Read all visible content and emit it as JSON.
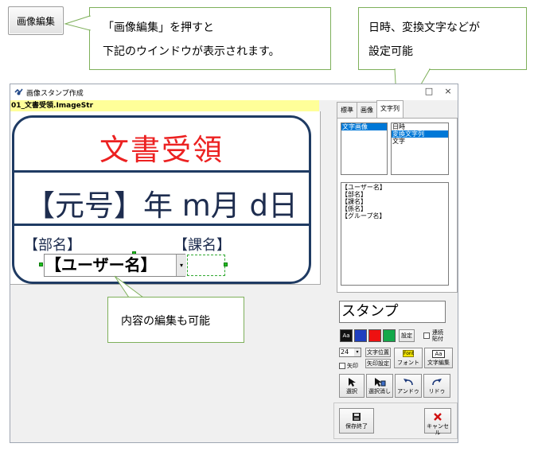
{
  "top_button": {
    "label": "画像編集"
  },
  "callouts": {
    "left": {
      "line1": "「画像編集」を押すと",
      "line2": "下記のウインドウが表示されます。"
    },
    "right": {
      "line1": "日時、変換文字などが",
      "line2": "設定可能"
    },
    "bottom": {
      "line1": "内容の編集も可能"
    }
  },
  "window": {
    "title": "画像スタンプ作成",
    "filename": "01_文書受領.ImageStr",
    "controls": {
      "maximize": "□",
      "close": "×"
    }
  },
  "stamp": {
    "title": "文書受領",
    "date_line": "【元号】年 m月 d日",
    "dept": "【部名】",
    "section": "【課名】",
    "edit_value": "【ユーザー名】",
    "edit_dropdown": "▾"
  },
  "panel": {
    "tabs": [
      "標準",
      "画像",
      "文字列"
    ],
    "active_tab": "文字列",
    "left_list": [
      "文字画像"
    ],
    "right_list": [
      "日時",
      "変換文字列",
      "文字"
    ],
    "right_list_selected": "変換文字列",
    "field_list": [
      "【ユーザー名】",
      "【部名】",
      "【課名】",
      "【係名】",
      "【グループ名】"
    ],
    "stamp_text": "スタンプ",
    "aa_label": "Aa",
    "settings_label": "設定",
    "continuous_paste": "連続\n貼付",
    "font_size": "24",
    "font_size_arrow": "▾",
    "arrow_checkbox": "矢印",
    "text_pos": "文字位置",
    "arrow_settings": "矢印設定",
    "font_btn": "フォント",
    "font_icon": "Font",
    "text_edit": "文字編集",
    "text_edit_icon": "Aa",
    "select": "選択",
    "deselect": "選択消し",
    "undo": "アンドゥ",
    "redo": "リドゥ",
    "save_close": "保存終了",
    "cancel": "キャンセル"
  },
  "colors": {
    "stamp_border": "#1f3b63",
    "stamp_title": "#ec2121",
    "swatch_blue": "#1f3fbf",
    "swatch_red": "#ee1111",
    "swatch_green": "#13a84a",
    "callout_border": "#7eb05a"
  }
}
